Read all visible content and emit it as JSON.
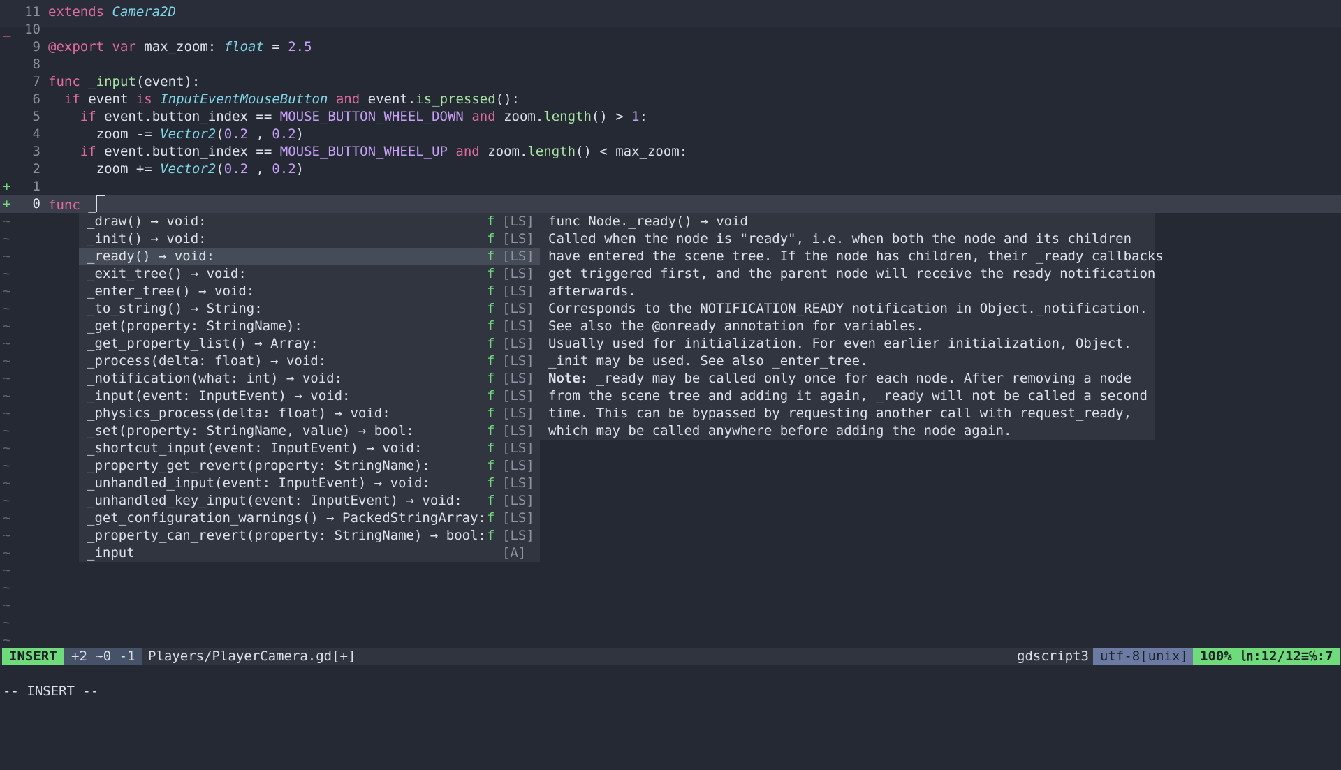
{
  "editor": {
    "lines": [
      {
        "num": "11",
        "sign": "",
        "tokens": [
          {
            "t": "extends ",
            "c": "kw"
          },
          {
            "t": "Camera2D",
            "c": "ty"
          }
        ]
      },
      {
        "num": "10",
        "sign": "_",
        "sign_c": "minus",
        "tokens": []
      },
      {
        "num": "9",
        "sign": "",
        "tokens": [
          {
            "t": "@export",
            "c": "kw"
          },
          {
            "t": " var",
            "c": "kw"
          },
          {
            "t": " max_zoom: ",
            "c": "op"
          },
          {
            "t": "float",
            "c": "ty"
          },
          {
            "t": " = ",
            "c": "op"
          },
          {
            "t": "2.5",
            "c": "num"
          }
        ]
      },
      {
        "num": "8",
        "sign": "",
        "tokens": []
      },
      {
        "num": "7",
        "sign": "",
        "tokens": [
          {
            "t": "func",
            "c": "kw"
          },
          {
            "t": " ",
            "c": "op"
          },
          {
            "t": "_input",
            "c": "fn"
          },
          {
            "t": "(event):",
            "c": "op"
          }
        ]
      },
      {
        "num": "6",
        "sign": "",
        "tokens": [
          {
            "t": "  if",
            "c": "kw"
          },
          {
            "t": " event ",
            "c": "op"
          },
          {
            "t": "is",
            "c": "kw"
          },
          {
            "t": " ",
            "c": "op"
          },
          {
            "t": "InputEventMouseButton",
            "c": "ty"
          },
          {
            "t": " ",
            "c": "op"
          },
          {
            "t": "and",
            "c": "kw"
          },
          {
            "t": " event.",
            "c": "op"
          },
          {
            "t": "is_pressed",
            "c": "fn"
          },
          {
            "t": "():",
            "c": "op"
          }
        ]
      },
      {
        "num": "5",
        "sign": "",
        "tokens": [
          {
            "t": "    if",
            "c": "kw"
          },
          {
            "t": " event.button_index == ",
            "c": "op"
          },
          {
            "t": "MOUSE_BUTTON_WHEEL_DOWN",
            "c": "const"
          },
          {
            "t": " ",
            "c": "op"
          },
          {
            "t": "and",
            "c": "kw"
          },
          {
            "t": " zoom.",
            "c": "op"
          },
          {
            "t": "length",
            "c": "fn"
          },
          {
            "t": "() > ",
            "c": "op"
          },
          {
            "t": "1",
            "c": "num"
          },
          {
            "t": ":",
            "c": "op"
          }
        ]
      },
      {
        "num": "4",
        "sign": "",
        "tokens": [
          {
            "t": "      zoom -= ",
            "c": "op"
          },
          {
            "t": "Vector2",
            "c": "ty"
          },
          {
            "t": "(",
            "c": "op"
          },
          {
            "t": "0.2",
            "c": "num"
          },
          {
            "t": " , ",
            "c": "op"
          },
          {
            "t": "0.2",
            "c": "num"
          },
          {
            "t": ")",
            "c": "op"
          }
        ]
      },
      {
        "num": "3",
        "sign": "",
        "tokens": [
          {
            "t": "    if",
            "c": "kw"
          },
          {
            "t": " event.button_index == ",
            "c": "op"
          },
          {
            "t": "MOUSE_BUTTON_WHEEL_UP",
            "c": "const"
          },
          {
            "t": " ",
            "c": "op"
          },
          {
            "t": "and",
            "c": "kw"
          },
          {
            "t": " zoom.",
            "c": "op"
          },
          {
            "t": "length",
            "c": "fn"
          },
          {
            "t": "() < max_zoom:",
            "c": "op"
          }
        ]
      },
      {
        "num": "2",
        "sign": "",
        "tokens": [
          {
            "t": "      zoom += ",
            "c": "op"
          },
          {
            "t": "Vector2",
            "c": "ty"
          },
          {
            "t": "(",
            "c": "op"
          },
          {
            "t": "0.2",
            "c": "num"
          },
          {
            "t": " , ",
            "c": "op"
          },
          {
            "t": "0.2",
            "c": "num"
          },
          {
            "t": ")",
            "c": "op"
          }
        ]
      },
      {
        "num": "1",
        "sign": "+",
        "sign_c": "plus",
        "tokens": []
      },
      {
        "num": "0",
        "sign": "+",
        "sign_c": "plus",
        "current": true,
        "tokens": [
          {
            "t": "func",
            "c": "kw"
          },
          {
            "t": " _",
            "c": "op"
          }
        ],
        "cursor": true
      }
    ],
    "tilde": "~",
    "tilde_count": 25
  },
  "completion": {
    "items": [
      {
        "label": "_draw() → void:",
        "kind": "f",
        "source": "[LS]"
      },
      {
        "label": "_init() → void:",
        "kind": "f",
        "source": "[LS]"
      },
      {
        "label": "_ready() → void:",
        "kind": "f",
        "source": "[LS]",
        "selected": true
      },
      {
        "label": "_exit_tree() → void:",
        "kind": "f",
        "source": "[LS]"
      },
      {
        "label": "_enter_tree() → void:",
        "kind": "f",
        "source": "[LS]"
      },
      {
        "label": "_to_string() → String:",
        "kind": "f",
        "source": "[LS]"
      },
      {
        "label": "_get(property: StringName):",
        "kind": "f",
        "source": "[LS]"
      },
      {
        "label": "_get_property_list() → Array:",
        "kind": "f",
        "source": "[LS]"
      },
      {
        "label": "_process(delta: float) → void:",
        "kind": "f",
        "source": "[LS]"
      },
      {
        "label": "_notification(what: int) → void:",
        "kind": "f",
        "source": "[LS]"
      },
      {
        "label": "_input(event: InputEvent) → void:",
        "kind": "f",
        "source": "[LS]"
      },
      {
        "label": "_physics_process(delta: float) → void:",
        "kind": "f",
        "source": "[LS]"
      },
      {
        "label": "_set(property: StringName, value) → bool:",
        "kind": "f",
        "source": "[LS]"
      },
      {
        "label": "_shortcut_input(event: InputEvent) → void:",
        "kind": "f",
        "source": "[LS]"
      },
      {
        "label": "_property_get_revert(property: StringName):",
        "kind": "f",
        "source": "[LS]"
      },
      {
        "label": "_unhandled_input(event: InputEvent) → void:",
        "kind": "f",
        "source": "[LS]"
      },
      {
        "label": "_unhandled_key_input(event: InputEvent) → void:",
        "kind": "f",
        "source": "[LS]"
      },
      {
        "label": "_get_configuration_warnings() → PackedStringArray:",
        "kind": "f",
        "source": "[LS]"
      },
      {
        "label": "_property_can_revert(property: StringName) → bool:",
        "kind": "f",
        "source": "[LS]"
      },
      {
        "label": "_input",
        "kind": "",
        "source": "[A]"
      }
    ]
  },
  "doc": {
    "lines": [
      "func Node._ready() → void",
      "Called when the node is \"ready\", i.e. when both the node and its children",
      "have entered the scene tree. If the node has children, their _ready callbacks",
      "get triggered first, and the parent node will receive the ready notification",
      "afterwards.",
      "Corresponds to the NOTIFICATION_READY notification in Object._notification.",
      "See also the @onready annotation for variables.",
      "Usually used for initialization. For even earlier initialization, Object.",
      "_init may be used. See also _enter_tree.",
      "_ready may be called only once for each node. After removing a node",
      "from the scene tree and adding it again, _ready will not be called a second",
      "time. This can be bypassed by requesting another call with request_ready,",
      "which may be called anywhere before adding the node again."
    ],
    "note_label": "Note:",
    "note_line_index": 9
  },
  "status": {
    "mode": "INSERT",
    "diff": "+2 ~0 -1",
    "file": "Players/PlayerCamera.gd[+]",
    "filetype": "gdscript3",
    "encoding": "utf-8[unix]",
    "position": "100% ㏑:12/12≡℅:7"
  },
  "cmdline": "-- INSERT --",
  "colors": {
    "background": "#252934",
    "keyword": "#e06c9f",
    "type": "#7fd6e6",
    "number": "#c6a0f6",
    "function": "#a6e3a1",
    "mode_insert": "#6fdc7c",
    "encoding_bg": "#6b7ba3"
  }
}
